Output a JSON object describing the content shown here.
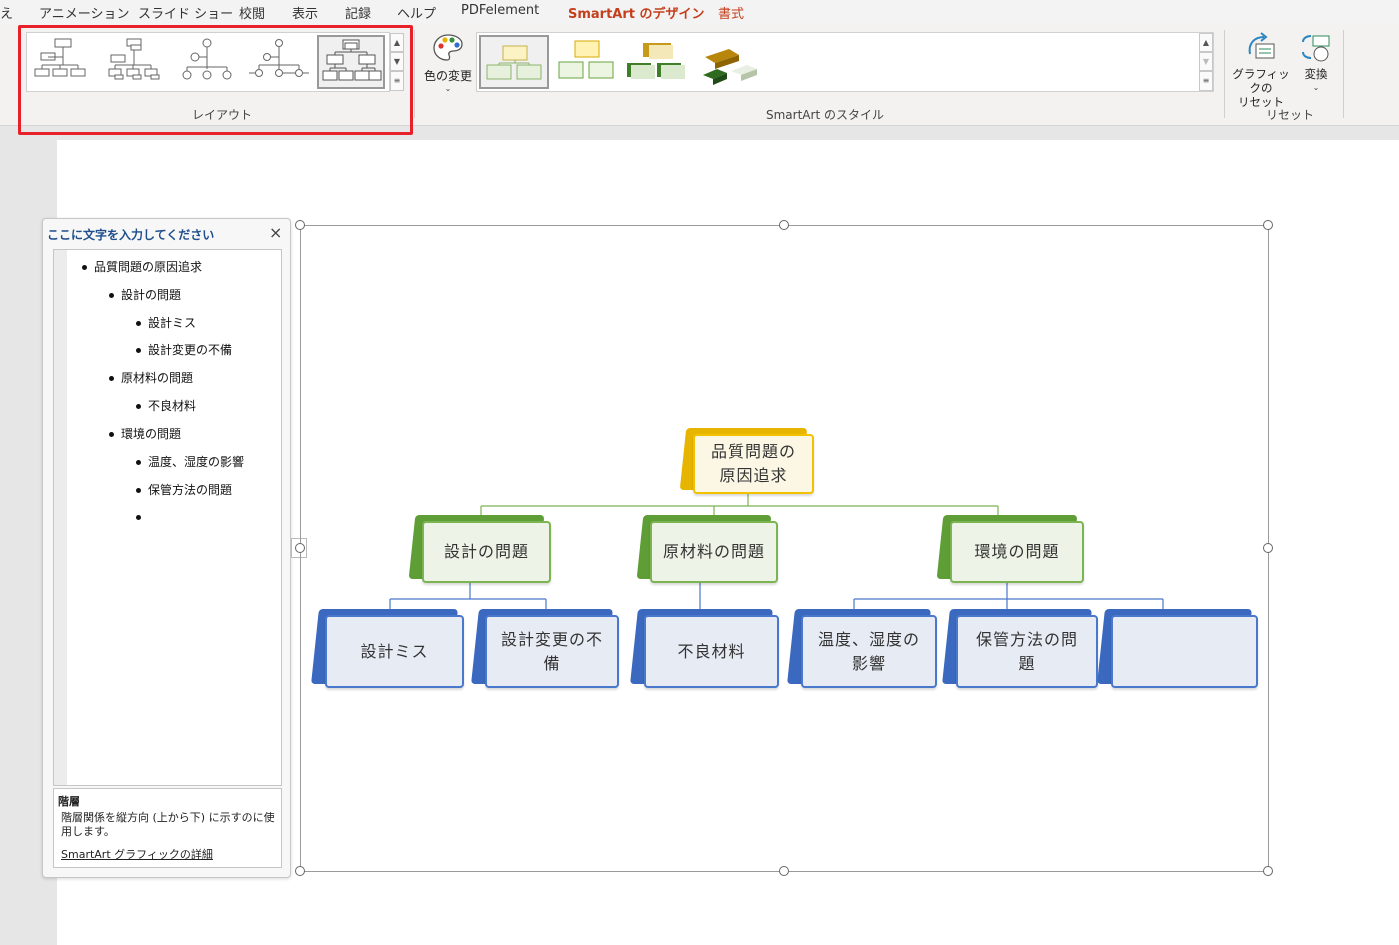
{
  "tabs": {
    "items": [
      "え",
      "アニメーション",
      "スライド ショー",
      "校閲",
      "表示",
      "記録",
      "ヘルプ",
      "PDFelement",
      "SmartArt のデザイン",
      "書式"
    ],
    "active": "SmartArt のデザイン"
  },
  "ribbon": {
    "layout_group_label": "レイアウト",
    "color_change_label": "色の変更",
    "styles_group_label": "SmartArt のスタイル",
    "reset_graphic_label_1": "グラフィックの",
    "reset_graphic_label_2": "リセット",
    "convert_label": "変換",
    "reset_group_label": "リセット"
  },
  "text_pane": {
    "title": "ここに文字を入力してください",
    "items": [
      {
        "text": "品質問題の原因追求",
        "level": 0
      },
      {
        "text": "設計の問題",
        "level": 1
      },
      {
        "text": "設計ミス",
        "level": 2
      },
      {
        "text": "設計変更の不備",
        "level": 2
      },
      {
        "text": "原材料の問題",
        "level": 1
      },
      {
        "text": "不良材料",
        "level": 2
      },
      {
        "text": "環境の問題",
        "level": 1
      },
      {
        "text": "温度、湿度の影響",
        "level": 2
      },
      {
        "text": "保管方法の問題",
        "level": 2
      },
      {
        "text": "",
        "level": 2
      }
    ],
    "desc_heading": "階層",
    "desc_text": "階層関係を縦方向 (上から下) に示すのに使用します。",
    "desc_link": "SmartArt グラフィックの詳細"
  },
  "smartart": {
    "root": "品質問題の原因追求",
    "level1": [
      "設計の問題",
      "原材料の問題",
      "環境の問題"
    ],
    "level2": [
      "設計ミス",
      "設計変更の不備",
      "不良材料",
      "温度、湿度の影響",
      "保管方法の問題",
      ""
    ],
    "colors": {
      "level0": "#f2c200",
      "level1": "#7bb451",
      "level2": "#4a78cc"
    }
  }
}
